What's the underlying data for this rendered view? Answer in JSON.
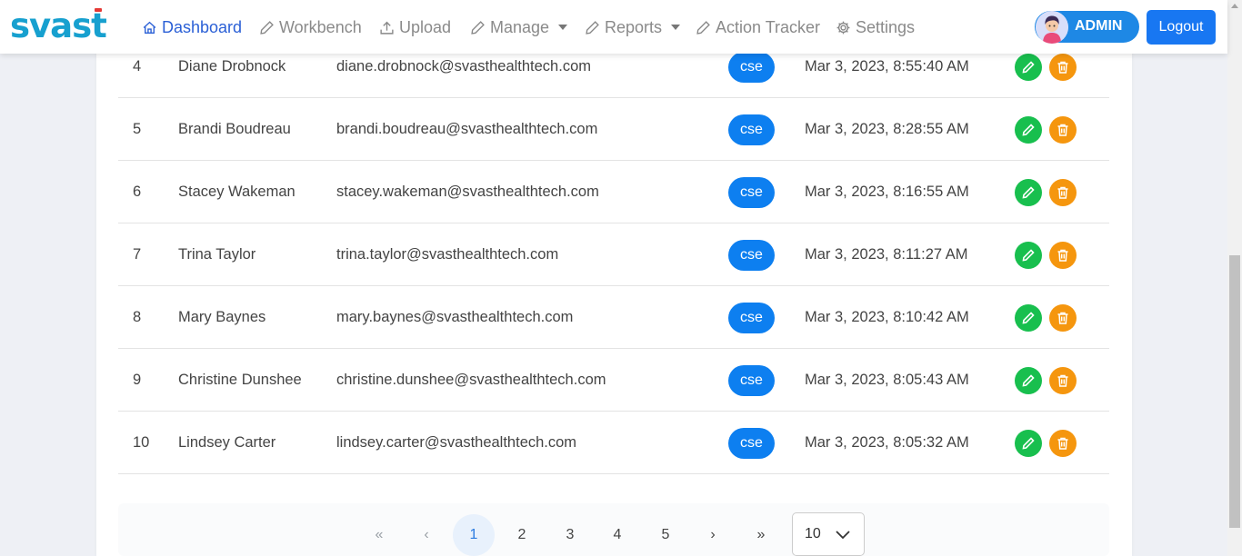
{
  "brand": {
    "logo_text_a": "svas",
    "logo_text_b": "t"
  },
  "nav": {
    "dashboard": "Dashboard",
    "workbench": "Workbench",
    "upload": "Upload",
    "manage": "Manage",
    "reports": "Reports",
    "action_tracker": "Action Tracker",
    "settings": "Settings"
  },
  "user": {
    "role_label": "ADMIN",
    "logout_label": "Logout"
  },
  "users_table": {
    "rows": [
      {
        "no": "4",
        "name": "Diane Drobnock",
        "email": "diane.drobnock@svasthealthtech.com",
        "role": "cse",
        "created": "Mar 3, 2023, 8:55:40 AM"
      },
      {
        "no": "5",
        "name": "Brandi Boudreau",
        "email": "brandi.boudreau@svasthealthtech.com",
        "role": "cse",
        "created": "Mar 3, 2023, 8:28:55 AM"
      },
      {
        "no": "6",
        "name": "Stacey Wakeman",
        "email": "stacey.wakeman@svasthealthtech.com",
        "role": "cse",
        "created": "Mar 3, 2023, 8:16:55 AM"
      },
      {
        "no": "7",
        "name": "Trina Taylor",
        "email": "trina.taylor@svasthealthtech.com",
        "role": "cse",
        "created": "Mar 3, 2023, 8:11:27 AM"
      },
      {
        "no": "8",
        "name": "Mary Baynes",
        "email": "mary.baynes@svasthealthtech.com",
        "role": "cse",
        "created": "Mar 3, 2023, 8:10:42 AM"
      },
      {
        "no": "9",
        "name": "Christine Dunshee",
        "email": "christine.dunshee@svasthealthtech.com",
        "role": "cse",
        "created": "Mar 3, 2023, 8:05:43 AM"
      },
      {
        "no": "10",
        "name": "Lindsey Carter",
        "email": "lindsey.carter@svasthealthtech.com",
        "role": "cse",
        "created": "Mar 3, 2023, 8:05:32 AM"
      }
    ]
  },
  "pagination": {
    "first": "«",
    "prev": "‹",
    "pages": [
      "1",
      "2",
      "3",
      "4",
      "5"
    ],
    "current_page": "1",
    "next": "›",
    "last": "»",
    "page_size": "10"
  },
  "icons": {
    "edit": "pencil-icon",
    "delete": "trash-icon",
    "dashboard": "home-icon",
    "settings": "gear-icon"
  },
  "colors": {
    "brand": "#17a0cf",
    "primary": "#1877f2",
    "role_badge": "#0d7ff0",
    "edit": "#18bf4e",
    "delete": "#f5960e",
    "active_nav": "#2b60d6"
  }
}
